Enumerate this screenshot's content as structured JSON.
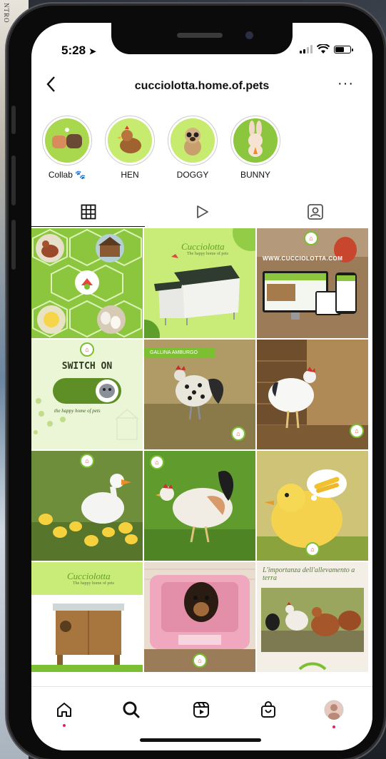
{
  "status": {
    "time": "5:28"
  },
  "header": {
    "username": "cucciolotta.home.of.pets",
    "more": "···"
  },
  "highlights": [
    {
      "label": "Collab 🐾"
    },
    {
      "label": "HEN"
    },
    {
      "label": "DOGGY"
    },
    {
      "label": "BUNNY"
    }
  ],
  "posts": {
    "p2_brand": "Cucciolotta",
    "p2_sub": "The happy home of pets",
    "p3_url": "WWW.CUCCIOLOTTA.COM",
    "p4_title": "SWITCH ON",
    "p4_sub": "the happy home of pets",
    "p5_title": "GALLINA AMBURGO",
    "p10_brand": "Cucciolotta",
    "p10_sub": "The happy home of pets",
    "p12_title": "L'importanza dell'allevamento a terra"
  },
  "colors": {
    "brand_green": "#8cc63f",
    "light_green": "#d8f0a8"
  },
  "background": {
    "edge_text": "NTRO"
  }
}
